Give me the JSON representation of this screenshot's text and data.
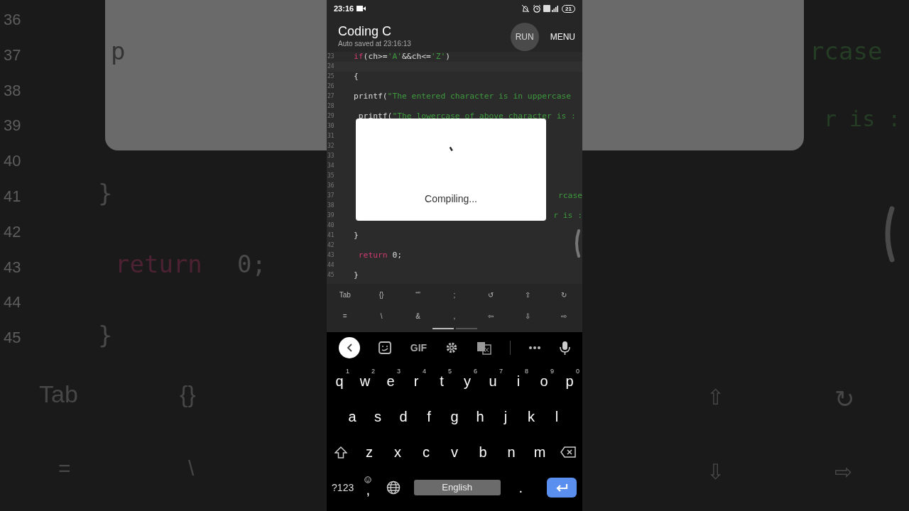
{
  "backdrop": {
    "items": [
      {
        "text": "36",
        "kind": "line_number"
      },
      {
        "text": "37",
        "kind": "line_number"
      },
      {
        "text": "38",
        "kind": "line_number"
      },
      {
        "text": "39",
        "kind": "line_number"
      },
      {
        "text": "40",
        "kind": "line_number"
      },
      {
        "text": "41",
        "kind": "line_number"
      },
      {
        "text": "42",
        "kind": "line_number"
      },
      {
        "text": "43",
        "kind": "line_number"
      },
      {
        "text": "44",
        "kind": "line_number"
      },
      {
        "text": "45",
        "kind": "line_number"
      },
      {
        "text": "p",
        "kind": "plain"
      },
      {
        "text": "}",
        "kind": "plain"
      },
      {
        "text": "return",
        "kind": "keyword"
      },
      {
        "text": "0;",
        "kind": "plain"
      },
      {
        "text": "}",
        "kind": "plain"
      },
      {
        "text": "rcase",
        "kind": "string"
      },
      {
        "text": "r is :",
        "kind": "string"
      },
      {
        "text": "Tab",
        "kind": "key"
      },
      {
        "text": "{}",
        "kind": "key"
      },
      {
        "text": "=",
        "kind": "key"
      },
      {
        "text": "\\",
        "kind": "key"
      },
      {
        "text": "⇧",
        "kind": "key"
      },
      {
        "text": "↻",
        "kind": "key"
      },
      {
        "text": "⇩",
        "kind": "key"
      },
      {
        "text": "⇨",
        "kind": "key"
      }
    ]
  },
  "status_bar": {
    "time": "23:16",
    "battery": "21"
  },
  "header": {
    "title": "Coding C",
    "subtitle": "Auto saved at 23:16:13",
    "run": "RUN",
    "menu": "MENU"
  },
  "editor": {
    "lines": [
      {
        "number": "23",
        "segments": [
          {
            "text": "if",
            "kind": "keyword"
          },
          {
            "text": "(ch>=",
            "kind": "plain"
          },
          {
            "text": "'A'",
            "kind": "string"
          },
          {
            "text": "&&ch<=",
            "kind": "plain"
          },
          {
            "text": "'Z'",
            "kind": "string"
          },
          {
            "text": ")",
            "kind": "plain"
          }
        ]
      },
      {
        "number": "24"
      },
      {
        "number": "25",
        "segments": [
          {
            "text": "{",
            "kind": "plain"
          }
        ]
      },
      {
        "number": "26"
      },
      {
        "number": "27",
        "segments": [
          {
            "text": "printf(",
            "kind": "plain"
          },
          {
            "text": "\"The entered character is in uppercase",
            "kind": "string"
          }
        ]
      },
      {
        "number": "28"
      },
      {
        "number": "29",
        "segments": [
          {
            "text": " printf(",
            "kind": "plain"
          },
          {
            "text": "\"The lowercase of above character is :",
            "kind": "string"
          }
        ]
      },
      {
        "number": "30"
      },
      {
        "number": "31"
      },
      {
        "number": "32"
      },
      {
        "number": "33"
      },
      {
        "number": "34"
      },
      {
        "number": "35"
      },
      {
        "number": "36"
      },
      {
        "number": "37",
        "tail": "rcase"
      },
      {
        "number": "38"
      },
      {
        "number": "39",
        "tail": "r is :"
      },
      {
        "number": "40"
      },
      {
        "number": "41",
        "segments": [
          {
            "text": "}",
            "kind": "plain"
          }
        ]
      },
      {
        "number": "42"
      },
      {
        "number": "43",
        "segments": [
          {
            "text": " return",
            "kind": "keyword"
          },
          {
            "text": " 0;",
            "kind": "plain"
          }
        ]
      },
      {
        "number": "44"
      },
      {
        "number": "45",
        "segments": [
          {
            "text": "}",
            "kind": "plain"
          }
        ]
      }
    ]
  },
  "dialog": {
    "message": "Compiling..."
  },
  "symbol_bar": {
    "rows": [
      [
        "Tab",
        "{}",
        "“”",
        ";",
        "↺",
        "⇧",
        "↻"
      ],
      [
        "=",
        "\\",
        "&",
        ",",
        "⇦",
        "⇩",
        "⇨"
      ]
    ],
    "pages": [
      {
        "selected": true
      },
      {
        "selected": false
      }
    ]
  },
  "keyboard": {
    "toolbar": {
      "gif": "GIF"
    },
    "rows": [
      {
        "keys": [
          {
            "kind": "letter",
            "label": "q",
            "hint": "1"
          },
          {
            "kind": "letter",
            "label": "w",
            "hint": "2"
          },
          {
            "kind": "letter",
            "label": "e",
            "hint": "3"
          },
          {
            "kind": "letter",
            "label": "r",
            "hint": "4"
          },
          {
            "kind": "letter",
            "label": "t",
            "hint": "5"
          },
          {
            "kind": "letter",
            "label": "y",
            "hint": "6"
          },
          {
            "kind": "letter",
            "label": "u",
            "hint": "7"
          },
          {
            "kind": "letter",
            "label": "i",
            "hint": "8"
          },
          {
            "kind": "letter",
            "label": "o",
            "hint": "9"
          },
          {
            "kind": "letter",
            "label": "p",
            "hint": "0"
          }
        ]
      },
      {
        "keys": [
          {
            "kind": "letter",
            "label": "a"
          },
          {
            "kind": "letter",
            "label": "s"
          },
          {
            "kind": "letter",
            "label": "d"
          },
          {
            "kind": "letter",
            "label": "f"
          },
          {
            "kind": "letter",
            "label": "g"
          },
          {
            "kind": "letter",
            "label": "h"
          },
          {
            "kind": "letter",
            "label": "j"
          },
          {
            "kind": "letter",
            "label": "k"
          },
          {
            "kind": "letter",
            "label": "l"
          }
        ]
      },
      {
        "keys": [
          {
            "kind": "shift"
          },
          {
            "kind": "letter",
            "label": "z"
          },
          {
            "kind": "letter",
            "label": "x"
          },
          {
            "kind": "letter",
            "label": "c"
          },
          {
            "kind": "letter",
            "label": "v"
          },
          {
            "kind": "letter",
            "label": "b"
          },
          {
            "kind": "letter",
            "label": "n"
          },
          {
            "kind": "letter",
            "label": "m"
          },
          {
            "kind": "backspace"
          }
        ]
      },
      {
        "keys": [
          {
            "kind": "symbols",
            "label": "?123"
          },
          {
            "kind": "emoji_comma",
            "label": ","
          },
          {
            "kind": "globe"
          },
          {
            "kind": "space",
            "label": "English"
          },
          {
            "kind": "period",
            "label": "."
          },
          {
            "kind": "enter"
          }
        ]
      }
    ]
  }
}
